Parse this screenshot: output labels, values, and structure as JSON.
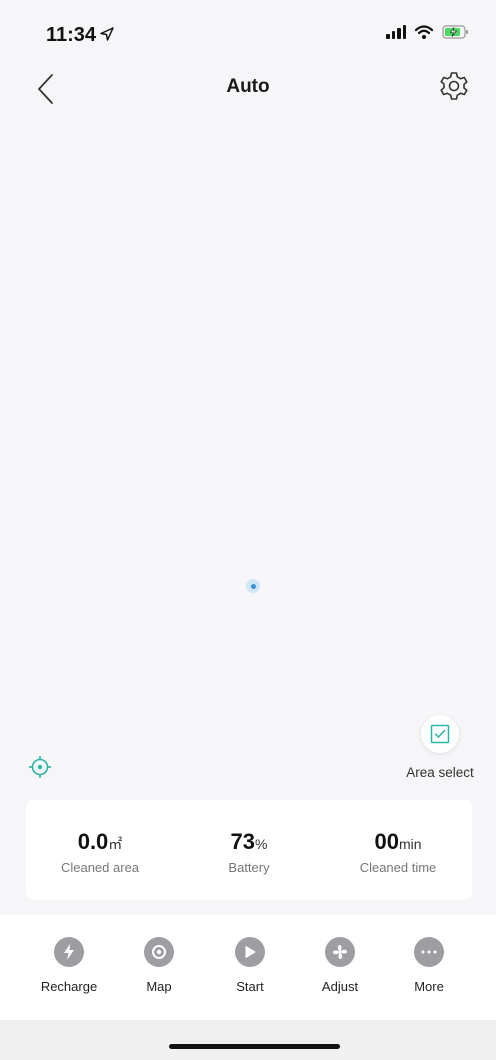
{
  "status_bar": {
    "time": "11:34",
    "icons": [
      "location-arrow-icon",
      "signal-icon",
      "wifi-icon",
      "battery-charging-icon"
    ]
  },
  "nav": {
    "title": "Auto",
    "back_icon": "back-chevron-icon",
    "settings_icon": "gear-icon"
  },
  "map": {
    "area_select_label": "Area select",
    "accent_color": "#2bb5a3",
    "robot_color": "#3d8fd1"
  },
  "stats": [
    {
      "value": "0.0",
      "unit": "㎡",
      "label": "Cleaned area"
    },
    {
      "value": "73",
      "unit": "%",
      "label": "Battery"
    },
    {
      "value": "00",
      "unit": "min",
      "label": "Cleaned time"
    }
  ],
  "actions": [
    {
      "label": "Recharge",
      "icon": "recharge-icon"
    },
    {
      "label": "Map",
      "icon": "map-pin-icon"
    },
    {
      "label": "Start",
      "icon": "play-icon"
    },
    {
      "label": "Adjust",
      "icon": "fan-icon"
    },
    {
      "label": "More",
      "icon": "more-dots-icon"
    }
  ]
}
